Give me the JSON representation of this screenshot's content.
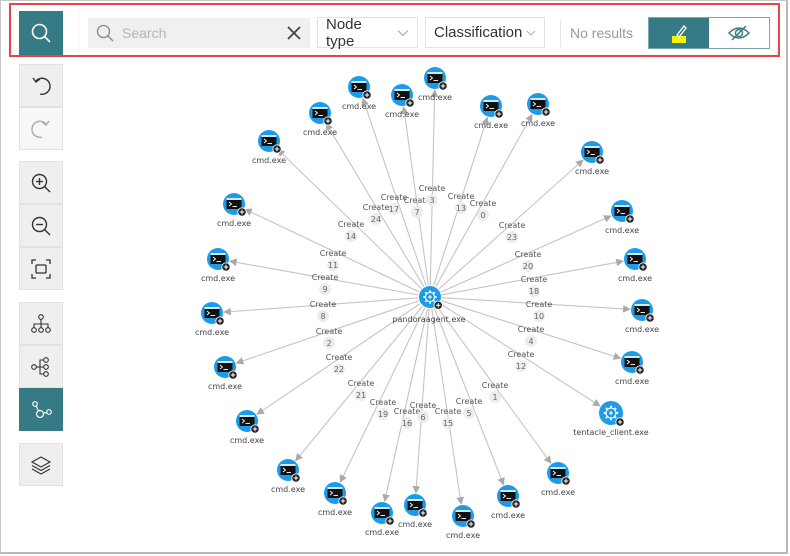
{
  "toolbar": {
    "search_placeholder": "Search",
    "search_value": "",
    "node_type_label": "Node type",
    "classification_label": "Classification",
    "results_text": "No results",
    "mode_buttons": [
      {
        "name": "edit-mode",
        "icon": "pencil-highlight-icon",
        "active": true
      },
      {
        "name": "hide-mode",
        "icon": "eye-slash-icon",
        "active": false
      }
    ]
  },
  "sidebar": {
    "search_toggle_icon": "search-icon",
    "groups": [
      [
        {
          "name": "undo",
          "icon": "undo-icon",
          "disabled": false
        },
        {
          "name": "redo",
          "icon": "redo-icon",
          "disabled": true
        }
      ],
      [
        {
          "name": "zoom-in",
          "icon": "zoom-in-icon"
        },
        {
          "name": "zoom-out",
          "icon": "zoom-out-icon"
        },
        {
          "name": "fit-to-screen",
          "icon": "fit-screen-icon"
        }
      ],
      [
        {
          "name": "hierarchical-layout",
          "icon": "hierarchy-icon"
        },
        {
          "name": "tree-layout",
          "icon": "tree-icon"
        },
        {
          "name": "organic-layout",
          "icon": "organic-graph-icon",
          "active": true
        }
      ],
      [
        {
          "name": "layers",
          "icon": "layers-icon"
        }
      ]
    ]
  },
  "graph": {
    "colors": {
      "node": "#1e9be8",
      "edge": "#c4c4c4",
      "accent": "#367a85",
      "highlight": "#e8434a"
    },
    "center": {
      "label": "pandoraagent.exe",
      "type": "service"
    },
    "edge_label": "Create",
    "nodes": [
      {
        "label": "cmd.exe",
        "type": "terminal",
        "edge": "17"
      },
      {
        "label": "cmd.exe",
        "type": "terminal",
        "edge": "7"
      },
      {
        "label": "cmd.exe",
        "type": "terminal",
        "edge": "3"
      },
      {
        "label": "cmd.exe",
        "type": "terminal",
        "edge": "24"
      },
      {
        "label": "cmd.exe",
        "type": "terminal",
        "edge": "14"
      },
      {
        "label": "cmd.exe",
        "type": "terminal",
        "edge": "11"
      },
      {
        "label": "cmd.exe",
        "type": "terminal",
        "edge": "9"
      },
      {
        "label": "cmd.exe",
        "type": "terminal",
        "edge": "8"
      },
      {
        "label": "cmd.exe",
        "type": "terminal",
        "edge": "2"
      },
      {
        "label": "cmd.exe",
        "type": "terminal",
        "edge": "22"
      },
      {
        "label": "cmd.exe",
        "type": "terminal",
        "edge": "21"
      },
      {
        "label": "cmd.exe",
        "type": "terminal",
        "edge": "19"
      },
      {
        "label": "cmd.exe",
        "type": "terminal",
        "edge": "16"
      },
      {
        "label": "cmd.exe",
        "type": "terminal",
        "edge": "6"
      },
      {
        "label": "cmd.exe",
        "type": "terminal",
        "edge": "15"
      },
      {
        "label": "cmd.exe",
        "type": "terminal",
        "edge": "5"
      },
      {
        "label": "cmd.exe",
        "type": "terminal",
        "edge": "1"
      },
      {
        "label": "tentacle_client.exe",
        "type": "service",
        "edge": "12"
      },
      {
        "label": "cmd.exe",
        "type": "terminal",
        "edge": "4"
      },
      {
        "label": "cmd.exe",
        "type": "terminal",
        "edge": "10"
      },
      {
        "label": "cmd.exe",
        "type": "terminal",
        "edge": "18"
      },
      {
        "label": "cmd.exe",
        "type": "terminal",
        "edge": "20"
      },
      {
        "label": "cmd.exe",
        "type": "terminal",
        "edge": "23"
      },
      {
        "label": "cmd.exe",
        "type": "terminal",
        "edge": "0"
      },
      {
        "label": "cmd.exe",
        "type": "terminal",
        "edge": "13"
      }
    ]
  }
}
